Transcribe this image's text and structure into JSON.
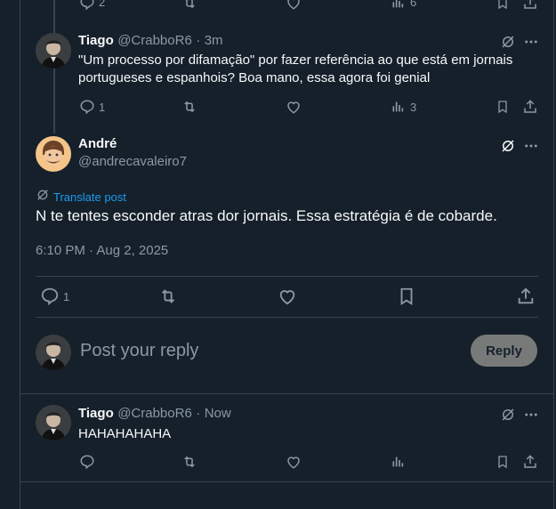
{
  "top_actions": {
    "reply_count": "2",
    "views_count": "6"
  },
  "reply1": {
    "name": "Tiago",
    "handle": "@CrabboR6",
    "dot": "·",
    "time": "3m",
    "text_line1": "\"Um processo por difamação\" por fazer referência ao que está em jornais",
    "text_line2": "portugueses e espanhois? Boa mano, essa agora foi genial",
    "reply_count": "1",
    "views_count": "3"
  },
  "main_post": {
    "name": "André",
    "handle": "@andrecavaleiro7",
    "translate_label": "Translate post",
    "text": "N te tentes esconder atras dor jornais. Essa estratégia é de cobarde.",
    "timestamp": "6:10 PM · Aug 2, 2025",
    "reply_count": "1"
  },
  "composer": {
    "placeholder": "Post your reply",
    "reply_button": "Reply"
  },
  "reply2": {
    "name": "Tiago",
    "handle": "@CrabboR6",
    "dot": "·",
    "time": "Now",
    "text": "HAHAHAHAHA"
  },
  "colors": {
    "background": "#15202b",
    "border": "#38444d",
    "text_primary": "#f7f9f9",
    "text_secondary": "#8b98a5",
    "link": "#1d9bf0"
  },
  "icons": [
    "reply-icon",
    "retweet-icon",
    "like-icon",
    "views-icon",
    "bookmark-icon",
    "share-icon",
    "grok-icon",
    "more-icon",
    "translate-icon"
  ]
}
